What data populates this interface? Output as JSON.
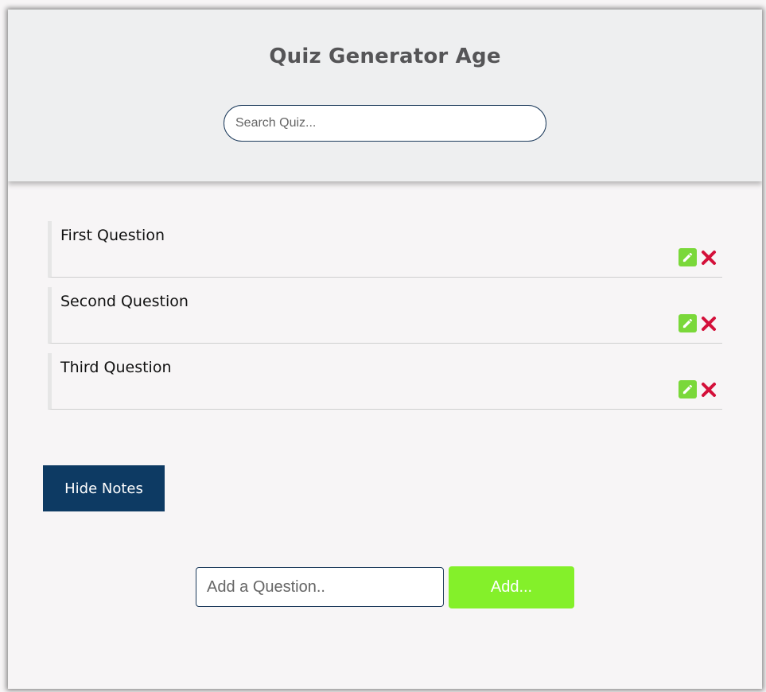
{
  "header": {
    "title": "Quiz Generator Age",
    "search_placeholder": "Search Quiz..."
  },
  "questions": [
    {
      "text": "First Question"
    },
    {
      "text": "Second Question"
    },
    {
      "text": "Third Question"
    }
  ],
  "toggle_label": "Hide Notes",
  "add_form": {
    "placeholder": "Add a Question..",
    "button_label": "Add..."
  },
  "icons": {
    "edit": "pencil-icon",
    "delete": "close-icon"
  },
  "colors": {
    "accent_green": "#84f02a",
    "edit_green": "#7ad83a",
    "delete_red": "#d4103a",
    "navy": "#0d3a63"
  }
}
